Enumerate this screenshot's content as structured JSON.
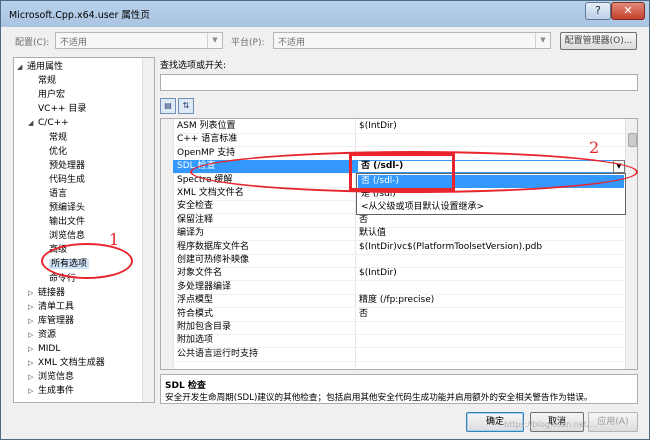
{
  "window": {
    "title": "Microsoft.Cpp.x64.user 属性页",
    "help_glyph": "?",
    "close_glyph": "✕"
  },
  "config": {
    "label": "配置(C):",
    "value": "不适用",
    "platform_label": "平台(P):",
    "platform_value": "不适用",
    "manager_button": "配置管理器(O)..."
  },
  "tree": {
    "items": [
      {
        "label": "通用属性",
        "expander": "◢"
      },
      {
        "label": "常规"
      },
      {
        "label": "用户宏"
      },
      {
        "label": "VC++ 目录"
      },
      {
        "label": "C/C++",
        "expander": "◢"
      },
      {
        "label": "常规"
      },
      {
        "label": "优化"
      },
      {
        "label": "预处理器"
      },
      {
        "label": "代码生成"
      },
      {
        "label": "语言"
      },
      {
        "label": "预编译头"
      },
      {
        "label": "输出文件"
      },
      {
        "label": "浏览信息"
      },
      {
        "label": "高级"
      },
      {
        "label": "所有选项"
      },
      {
        "label": "命令行"
      },
      {
        "label": "链接器",
        "expander": "▷"
      },
      {
        "label": "清单工具",
        "expander": "▷"
      },
      {
        "label": "库管理器",
        "expander": "▷"
      },
      {
        "label": "资源",
        "expander": "▷"
      },
      {
        "label": "MIDL",
        "expander": "▷"
      },
      {
        "label": "XML 文档生成器",
        "expander": "▷"
      },
      {
        "label": "浏览信息",
        "expander": "▷"
      },
      {
        "label": "生成事件",
        "expander": "▷"
      }
    ]
  },
  "search": {
    "label": "查找选项或开关:",
    "value": ""
  },
  "grid": {
    "rows": [
      {
        "name": "ASM 列表位置",
        "value": "$(IntDir)"
      },
      {
        "name": "C++ 语言标准",
        "value": ""
      },
      {
        "name": "OpenMP 支持",
        "value": ""
      },
      {
        "name": "SDL 检查",
        "value": "否 (/sdl-)"
      },
      {
        "name": "Spectre 缓解",
        "value": ""
      },
      {
        "name": "XML 文档文件名",
        "value": ""
      },
      {
        "name": "安全检查",
        "value": ""
      },
      {
        "name": "保留注释",
        "value": "否"
      },
      {
        "name": "编译为",
        "value": "默认值"
      },
      {
        "name": "程序数据库文件名",
        "value": "$(IntDir)vc$(PlatformToolsetVersion).pdb"
      },
      {
        "name": "创建可热修补映像",
        "value": ""
      },
      {
        "name": "对象文件名",
        "value": "$(IntDir)"
      },
      {
        "name": "多处理器编译",
        "value": ""
      },
      {
        "name": "浮点模型",
        "value": "精度 (/fp:precise)"
      },
      {
        "name": "符合模式",
        "value": "否"
      },
      {
        "name": "附加包含目录",
        "value": ""
      },
      {
        "name": "附加选项",
        "value": ""
      },
      {
        "name": "公共语言运行时支持",
        "value": ""
      }
    ],
    "dropdown": {
      "arrow": "▼",
      "options": [
        "否 (/sdl-)",
        "是 (/sdl)",
        "<从父级或项目默认设置继承>"
      ]
    }
  },
  "description": {
    "title": "SDL 检查",
    "text": "安全开发生命周期(SDL)建议的其他检查；包括启用其他安全代码生成功能并启用额外的安全相关警告作为错误。"
  },
  "buttons": {
    "ok": "确定",
    "cancel": "取消",
    "apply": "应用(A)"
  },
  "annotations": {
    "one": "1",
    "two": "2"
  },
  "watermark": "https://blog.csdn.net/...",
  "colors": {
    "selection": "#3399ff",
    "annotation_red": "#e8242c"
  }
}
